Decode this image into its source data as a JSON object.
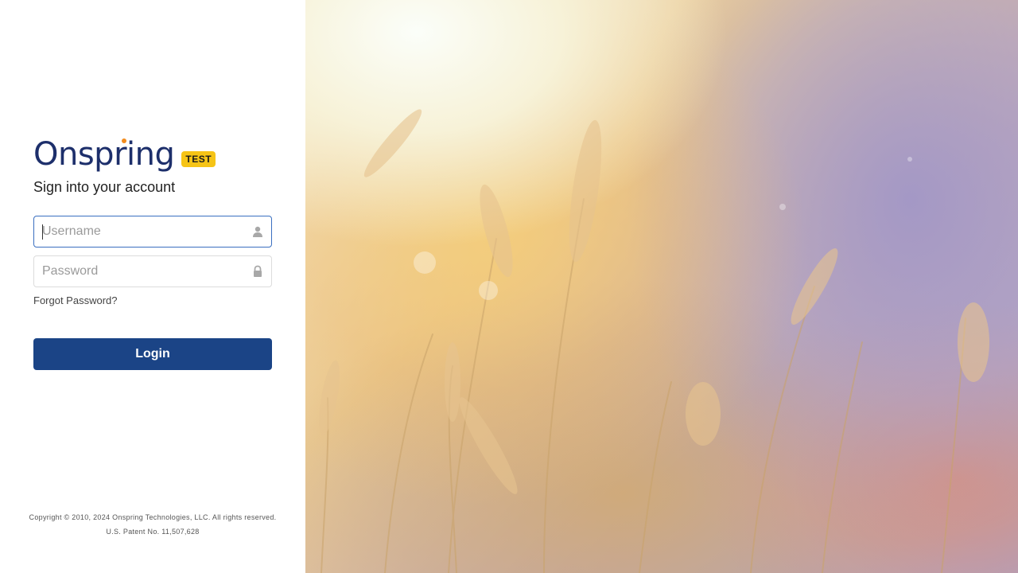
{
  "brand": {
    "logo_text": "Onspring",
    "env_badge": "TEST",
    "accent_color": "#1b4486",
    "badge_color": "#f6c416",
    "dot_color": "#f28c1e"
  },
  "login": {
    "subtitle": "Sign into your account",
    "username": {
      "placeholder": "Username",
      "value": "",
      "icon": "user-icon"
    },
    "password": {
      "placeholder": "Password",
      "value": "",
      "icon": "lock-icon"
    },
    "forgot_label": "Forgot Password?",
    "login_label": "Login"
  },
  "footer": {
    "copyright": "Copyright © 2010, 2024 Onspring Technologies, LLC. All rights reserved.",
    "patent": "U.S. Patent No. 11,507,628"
  }
}
